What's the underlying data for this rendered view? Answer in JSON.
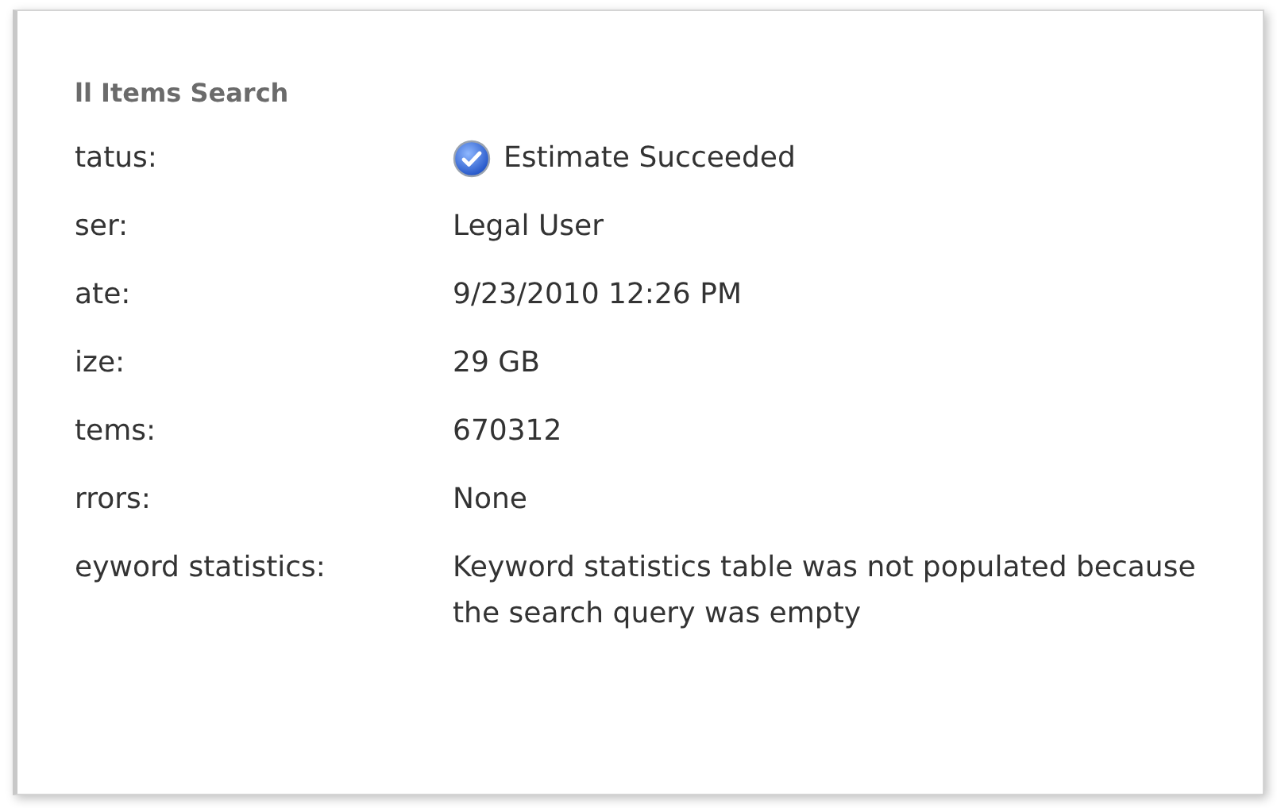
{
  "panel": {
    "title": "ll Items Search",
    "rows": [
      {
        "label": "tatus:",
        "value": "Estimate Succeeded",
        "kind": "status"
      },
      {
        "label": "ser:",
        "value": "Legal User",
        "kind": "text"
      },
      {
        "label": "ate:",
        "value": "9/23/2010 12:26 PM",
        "kind": "text"
      },
      {
        "label": "ize:",
        "value": "29 GB",
        "kind": "text"
      },
      {
        "label": "tems:",
        "value": "670312",
        "kind": "text"
      },
      {
        "label": "rrors:",
        "value": "None",
        "kind": "text"
      },
      {
        "label": "eyword statistics:",
        "value": "Keyword statistics table was not populated because the search query was empty",
        "kind": "text"
      }
    ]
  }
}
